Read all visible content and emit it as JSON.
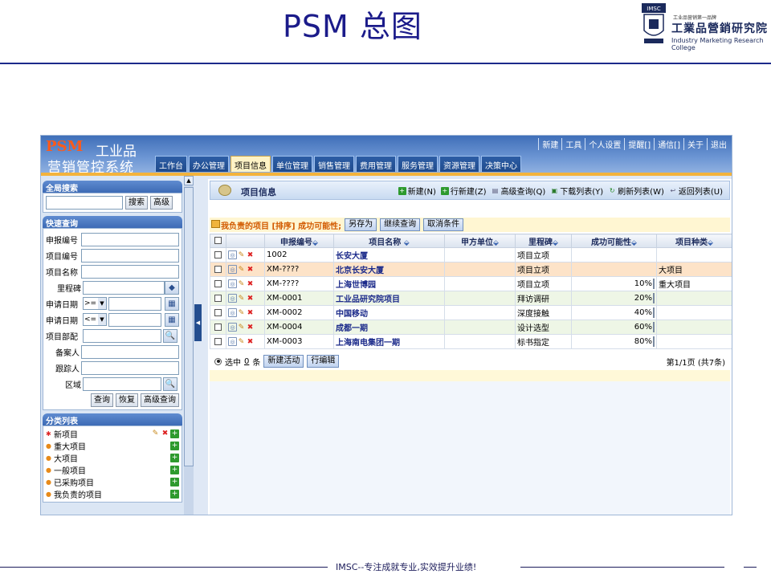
{
  "slide": {
    "title": "PSM 总图",
    "logo_small": "工业品营销第一品牌",
    "logo_cn": "工業品營銷研究院",
    "logo_en": "Industry Marketing Research College",
    "logo_crest": "IMSC",
    "footer": "IMSC--专注成就专业,实效提升业绩!"
  },
  "app": {
    "brand_psm": "PSM",
    "brand_cn1": "工业品",
    "brand_cn2": "营销管控系统",
    "top_links": [
      "新建",
      "工具",
      "个人设置",
      "提醒[]",
      "通信[]",
      "关于",
      "退出"
    ],
    "nav_tabs": [
      "工作台",
      "办公管理",
      "项目信息",
      "单位管理",
      "销售管理",
      "费用管理",
      "服务管理",
      "资源管理",
      "决策中心"
    ],
    "active_tab": "项目信息"
  },
  "sidebar": {
    "global_search": {
      "title": "全局搜索",
      "placeholder": "",
      "search_btn": "搜索",
      "advanced_btn": "高级"
    },
    "quick_query": {
      "title": "快速查询",
      "fields": [
        {
          "label": "申报编号"
        },
        {
          "label": "项目编号"
        },
        {
          "label": "项目名称"
        },
        {
          "label": "里程碑"
        },
        {
          "label": "申请日期",
          "op": ">="
        },
        {
          "label": "申请日期",
          "op": "<="
        },
        {
          "label": "项目部配"
        },
        {
          "label": "备案人"
        },
        {
          "label": "跟踪人"
        },
        {
          "label": "区域"
        }
      ],
      "buttons": [
        "查询",
        "恢复",
        "高级查询"
      ]
    },
    "categories": {
      "title": "分类列表",
      "items": [
        {
          "label": "新项目",
          "bullet": "✱"
        },
        {
          "label": "重大项目",
          "bullet": "●"
        },
        {
          "label": "大项目",
          "bullet": "●"
        },
        {
          "label": "一般项目",
          "bullet": "●"
        },
        {
          "label": "已采购项目",
          "bullet": "●"
        },
        {
          "label": "我负责的项目",
          "bullet": "●"
        }
      ]
    }
  },
  "main": {
    "title": "项目信息",
    "toolbar": [
      "新建(N)",
      "行新建(Z)",
      "高级查询(Q)",
      "下载列表(Y)",
      "刷新列表(W)",
      "返回列表(U)"
    ],
    "filter": {
      "label": "我负责的项目  [排序] 成功可能性;",
      "buttons": [
        "另存为",
        "继续查询",
        "取消条件"
      ]
    },
    "columns": [
      "申报编号",
      "项目名称",
      "甲方单位",
      "里程碑",
      "成功可能性",
      "项目种类"
    ],
    "rows": [
      {
        "code": "1002",
        "name": "长安大厦",
        "client": "",
        "milestone": "项目立项",
        "prob_text": "",
        "prob": null,
        "type": ""
      },
      {
        "code": "XM-????",
        "name": "北京长安大厦",
        "client": "",
        "milestone": "项目立项",
        "prob_text": "",
        "prob": null,
        "type": "大项目"
      },
      {
        "code": "XM-????",
        "name": "上海世博园",
        "client": "",
        "milestone": "项目立项",
        "prob_text": "10%",
        "prob": 0.1,
        "type": "重大项目"
      },
      {
        "code": "XM-0001",
        "name": "工业品研究院项目",
        "client": "",
        "milestone": "拜访调研",
        "prob_text": "20%",
        "prob": 0.2,
        "type": ""
      },
      {
        "code": "XM-0002",
        "name": "中国移动",
        "client": "",
        "milestone": "深度接触",
        "prob_text": "40%",
        "prob": 0.4,
        "type": ""
      },
      {
        "code": "XM-0004",
        "name": "成都一期",
        "client": "",
        "milestone": "设计选型",
        "prob_text": "60%",
        "prob": 0.6,
        "type": ""
      },
      {
        "code": "XM-0003",
        "name": "上海南电集团一期",
        "client": "",
        "milestone": "标书指定",
        "prob_text": "80%",
        "prob": 0.8,
        "type": ""
      }
    ],
    "row_colors": [
      "#ffffff",
      "#fde3c8",
      "#ffffff",
      "#eef6e6",
      "#ffffff",
      "#eef6e6",
      "#ffffff"
    ],
    "bar_colors": [
      "#5a7fe0",
      "#4ad6e8",
      "#5a8fe8",
      "#22dd22",
      "#f4f000"
    ],
    "footer": {
      "selected_prefix": "选中",
      "selected_count": "0",
      "selected_suffix": "条",
      "buttons": [
        "新建活动",
        "行编辑"
      ],
      "pager": "第1/1页 (共7条)"
    }
  }
}
